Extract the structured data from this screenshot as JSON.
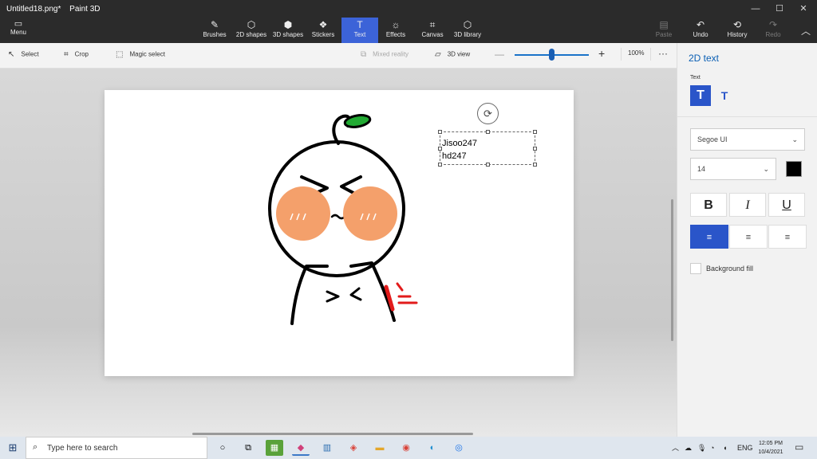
{
  "window": {
    "filename": "Untitled18.png*",
    "app_name": "Paint 3D",
    "minimize": "—",
    "maximize": "☐",
    "close": "✕"
  },
  "toolbar": {
    "menu_label": "Menu",
    "tools": [
      {
        "label": "Brushes",
        "icon": "brush-icon",
        "glyph": "✎"
      },
      {
        "label": "2D shapes",
        "icon": "2d-shapes-icon",
        "glyph": "⬡"
      },
      {
        "label": "3D shapes",
        "icon": "3d-shapes-icon",
        "glyph": "⬢"
      },
      {
        "label": "Stickers",
        "icon": "stickers-icon",
        "glyph": "❖"
      },
      {
        "label": "Text",
        "icon": "text-icon",
        "glyph": "T"
      },
      {
        "label": "Effects",
        "icon": "effects-icon",
        "glyph": "☼"
      },
      {
        "label": "Canvas",
        "icon": "canvas-icon",
        "glyph": "⌗"
      },
      {
        "label": "3D library",
        "icon": "3d-library-icon",
        "glyph": "⬡"
      },
      {
        "label": "Paste",
        "icon": "paste-icon",
        "glyph": "📋"
      },
      {
        "label": "Undo",
        "icon": "undo-icon",
        "glyph": "↶"
      },
      {
        "label": "History",
        "icon": "history-icon",
        "glyph": "⟲"
      },
      {
        "label": "Redo",
        "icon": "redo-icon",
        "glyph": "↷"
      }
    ],
    "active_tool": "Text"
  },
  "command_bar": {
    "select": "Select",
    "crop": "Crop",
    "magic_select": "Magic select",
    "mixed_reality": "Mixed reality",
    "view_3d": "3D view",
    "zoom_level": "100%",
    "zoom_fraction": 0.5,
    "more": "···"
  },
  "canvas": {
    "text_line1": "Jisoo247",
    "text_line2": "hd247"
  },
  "panel": {
    "title": "2D text",
    "subtitle": "Text",
    "font": "Segoe UI",
    "size": "14",
    "text_color": "#000000",
    "bold": "B",
    "italic": "I",
    "underline": "U",
    "align_left": "≡",
    "align_center": "≡",
    "align_right": "≡",
    "background_fill": "Background fill"
  },
  "taskbar": {
    "search_placeholder": "Type here to search",
    "language": "ENG",
    "time": "12:05 PM",
    "date": "10/4/2021"
  },
  "colors": {
    "accent": "#2a55c9",
    "title_text": "#0a5fb4",
    "blush": "#f4a06b",
    "leaf": "#22aa33",
    "mark": "#e21b1b"
  }
}
